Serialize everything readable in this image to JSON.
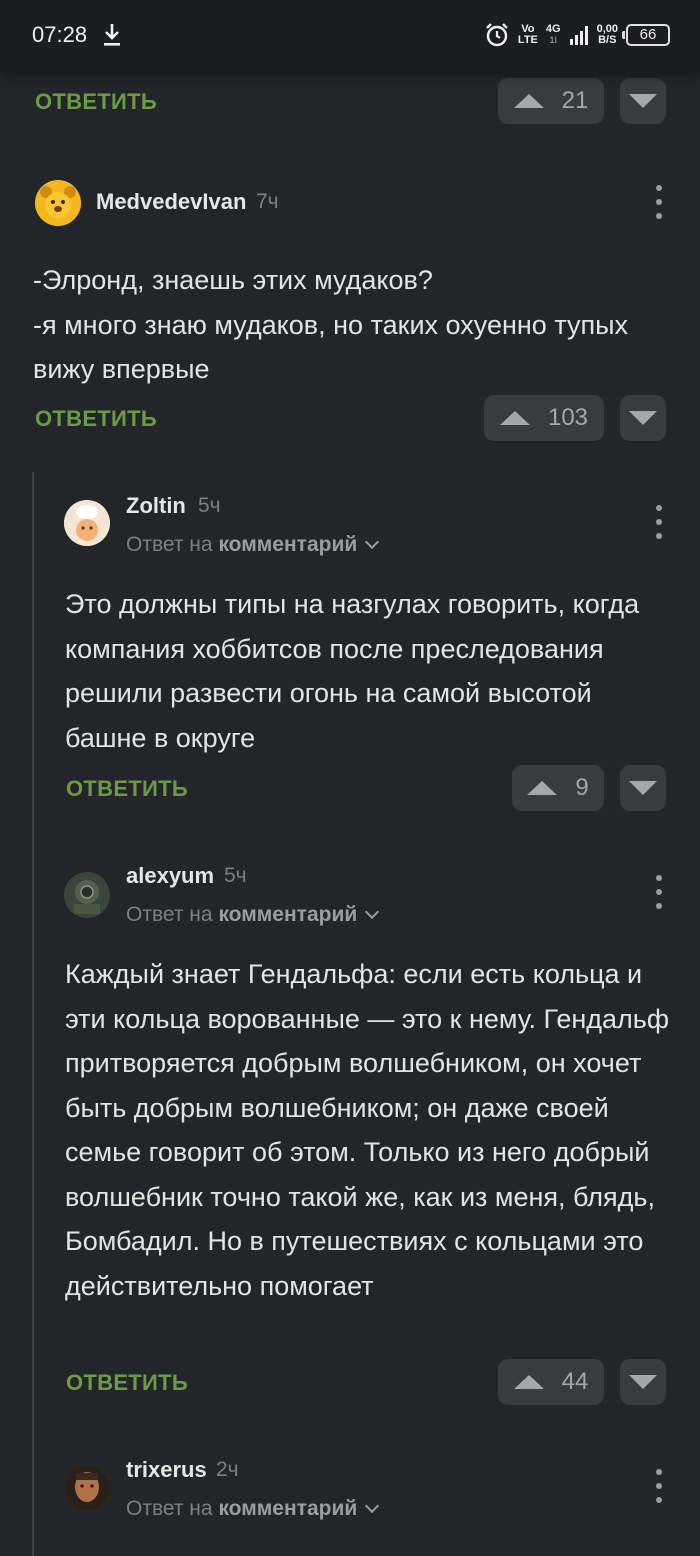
{
  "status_bar": {
    "time": "07:28",
    "volte_top": "Vo",
    "volte_bottom": "LTE",
    "network": "4G",
    "network_sub": "1l",
    "speed_top": "0,00",
    "speed_bottom": "B/S",
    "battery": "66",
    "icons": [
      "download-icon",
      "alarm-icon",
      "signal-icon",
      "battery-icon"
    ]
  },
  "reply_label": "ОТВЕТИТЬ",
  "reply_to_prefix": "Ответ на",
  "reply_to_target": "комментарий",
  "top_partial": {
    "rating": "21"
  },
  "comments": [
    {
      "author": "MedvedevIvan",
      "time": "7ч",
      "text": "-Элронд, знаешь этих мудаков?\n-я много знаю мудаков, но таких охуенно тупых вижу впервые",
      "rating": "103"
    },
    {
      "author": "Zoltin",
      "time": "5ч",
      "text": "Это должны типы на назгулах говорить, когда компания хоббитсов после преследования решили развести огонь на самой высотой башне в округе",
      "rating": "9"
    },
    {
      "author": "alexyum",
      "time": "5ч",
      "text": "Каждый знает Гендальфа: если есть кольца и эти кольца ворованные — это к нему. Гендальф притворяется добрым волшебником, он хочет быть добрым волшебником; он даже своей семье говорит об этом. Только из него добрый волшебник точно такой же, как из меня, блядь, Бомбадил. Но в путешествиях с кольцами это действительно помогает",
      "rating": "44"
    },
    {
      "author": "trixerus",
      "time": "2ч"
    }
  ],
  "colors": {
    "background": "#222529",
    "reply_green": "#6f9a45",
    "vote_bg": "#383b40",
    "muted": "#7c7f84"
  }
}
